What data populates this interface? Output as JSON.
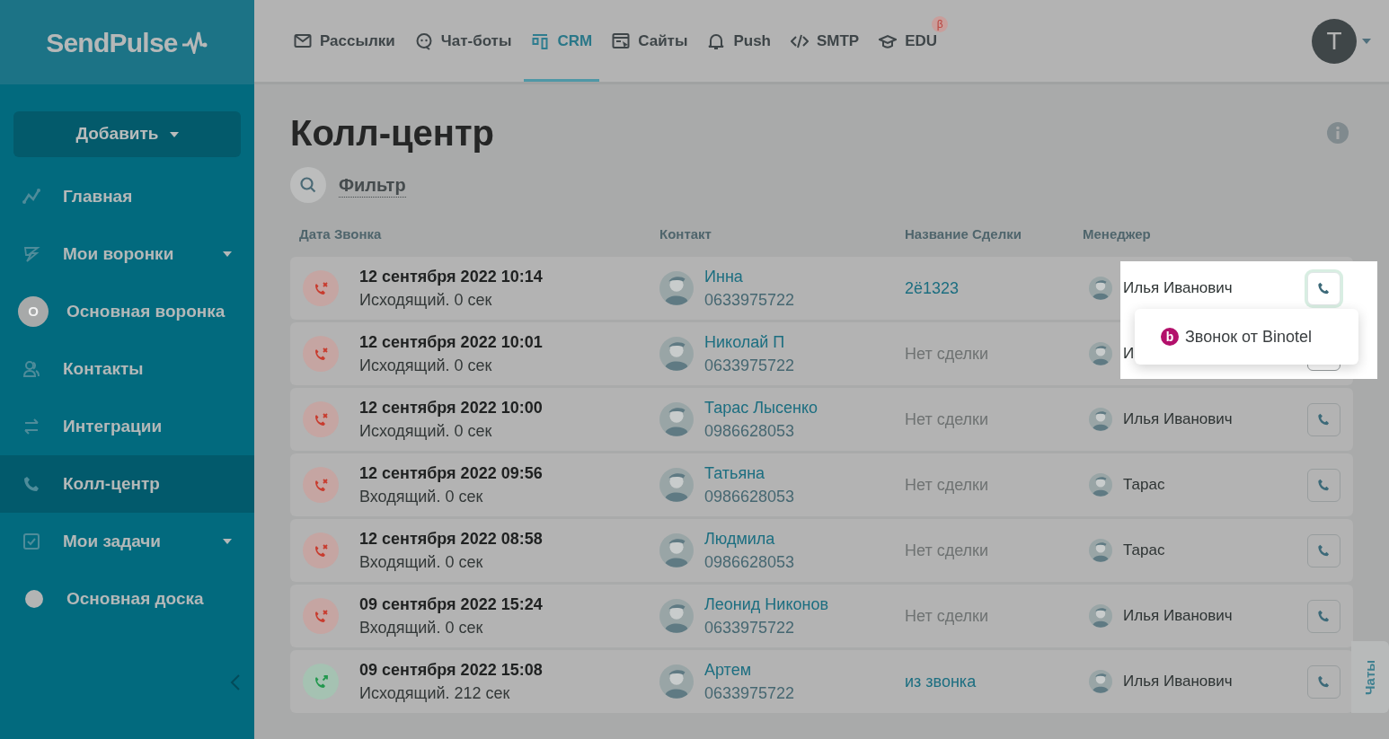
{
  "logo": "SendPulse",
  "top_nav": [
    {
      "label": "Рассылки",
      "selected": false
    },
    {
      "label": "Чат-боты",
      "selected": false
    },
    {
      "label": "CRM",
      "selected": true
    },
    {
      "label": "Сайты",
      "selected": false
    },
    {
      "label": "Push",
      "selected": false
    },
    {
      "label": "SMTP",
      "selected": false
    },
    {
      "label": "EDU",
      "selected": false,
      "badge": "β"
    }
  ],
  "user": {
    "initial": "T"
  },
  "sidebar": {
    "add_button": "Добавить",
    "items": [
      {
        "label": "Главная",
        "kind": "icon",
        "submenu": false,
        "selected": false
      },
      {
        "label": "Мои воронки",
        "kind": "icon",
        "submenu": true,
        "selected": false
      },
      {
        "label": "Основная воронка",
        "kind": "letter",
        "letter": "О",
        "submenu": false,
        "selected": false
      },
      {
        "label": "Контакты",
        "kind": "icon",
        "submenu": false,
        "selected": false
      },
      {
        "label": "Интеграции",
        "kind": "icon",
        "submenu": false,
        "selected": false
      },
      {
        "label": "Колл-центр",
        "kind": "icon",
        "submenu": false,
        "selected": true
      },
      {
        "label": "Мои задачи",
        "kind": "icon",
        "submenu": true,
        "selected": false
      },
      {
        "label": "Основная доска",
        "kind": "dot",
        "submenu": false,
        "selected": false
      }
    ]
  },
  "page": {
    "title": "Колл-центр",
    "filter": "Фильтр"
  },
  "table": {
    "columns": [
      "Дата Звонка",
      "Контакт",
      "Название Сделки",
      "Менеджер"
    ],
    "rows": [
      {
        "kind": "missed",
        "date": "12 сентября 2022 10:14",
        "call": "Исходящий. 0 сек",
        "contact": "Инна",
        "phone": "0633975722",
        "deal": "2ё1323",
        "has_deal": true,
        "manager": "Илья Иванович"
      },
      {
        "kind": "missed",
        "date": "12 сентября 2022 10:01",
        "call": "Исходящий. 0 сек",
        "contact": "Николай П",
        "phone": "0633975722",
        "deal": "Нет сделки",
        "has_deal": false,
        "manager": "И"
      },
      {
        "kind": "missed",
        "date": "12 сентября 2022 10:00",
        "call": "Исходящий. 0 сек",
        "contact": "Тарас Лысенко",
        "phone": "0986628053",
        "deal": "Нет сделки",
        "has_deal": false,
        "manager": "Илья Иванович"
      },
      {
        "kind": "missed",
        "date": "12 сентября 2022 09:56",
        "call": "Входящий. 0 сек",
        "contact": "Татьяна",
        "phone": "0986628053",
        "deal": "Нет сделки",
        "has_deal": false,
        "manager": "Тарас"
      },
      {
        "kind": "missed",
        "date": "12 сентября 2022 08:58",
        "call": "Входящий. 0 сек",
        "contact": "Людмила",
        "phone": "0986628053",
        "deal": "Нет сделки",
        "has_deal": false,
        "manager": "Тарас"
      },
      {
        "kind": "missed",
        "date": "09 сентября 2022 15:24",
        "call": "Входящий. 0 сек",
        "contact": "Леонид Никонов",
        "phone": "0633975722",
        "deal": "Нет сделки",
        "has_deal": false,
        "manager": "Илья Иванович"
      },
      {
        "kind": "completed",
        "date": "09 сентября 2022 15:08",
        "call": "Исходящий. 212 сек",
        "contact": "Артем",
        "phone": "0633975722",
        "deal": "из звонка",
        "has_deal": true,
        "manager": "Илья Иванович"
      }
    ]
  },
  "call_menu": {
    "items": [
      {
        "badge": "b",
        "label": "Звонок от Binotel"
      }
    ]
  },
  "chats_tab": "Чаты"
}
